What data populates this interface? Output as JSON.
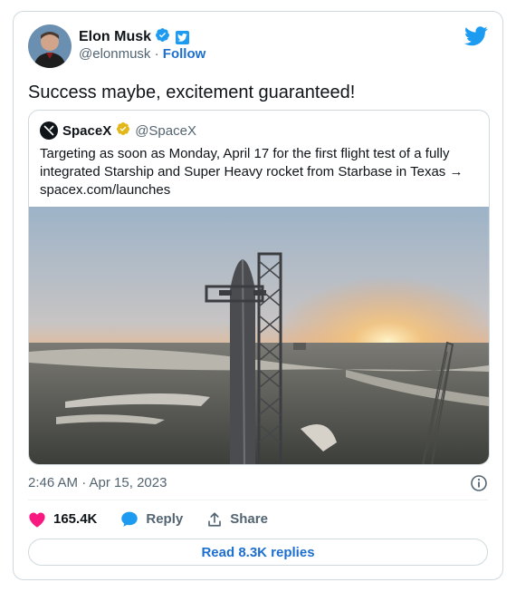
{
  "author": {
    "name": "Elon Musk",
    "handle": "@elonmusk",
    "separator": "·",
    "follow_label": "Follow"
  },
  "tweet": {
    "text": "Success maybe, excitement guaranteed!",
    "timestamp": "2:46 AM · Apr 15, 2023"
  },
  "quoted_tweet": {
    "name": "SpaceX",
    "handle": "@SpaceX",
    "text_line1": "Targeting as soon as Monday, April 17 for the first flight test of a fully",
    "text_line2": "integrated Starship and Super Heavy rocket from Starbase in Texas →",
    "text_line3": "spacex.com/launches",
    "image_icon": "starship-launch-tower-photo"
  },
  "actions": {
    "like_count": "165.4K",
    "reply_label": "Reply",
    "share_label": "Share",
    "read_replies_label": "Read 8.3K replies"
  },
  "colors": {
    "twitter_blue": "#1d9bf0",
    "like_pink": "#f91880",
    "verified_gold": "#e2b719",
    "text_secondary": "#536471"
  },
  "icons": [
    "verified-icon",
    "twitter-icon",
    "bird-icon",
    "spacex-logo-icon",
    "info-icon",
    "heart-icon",
    "reply-icon",
    "share-icon"
  ]
}
